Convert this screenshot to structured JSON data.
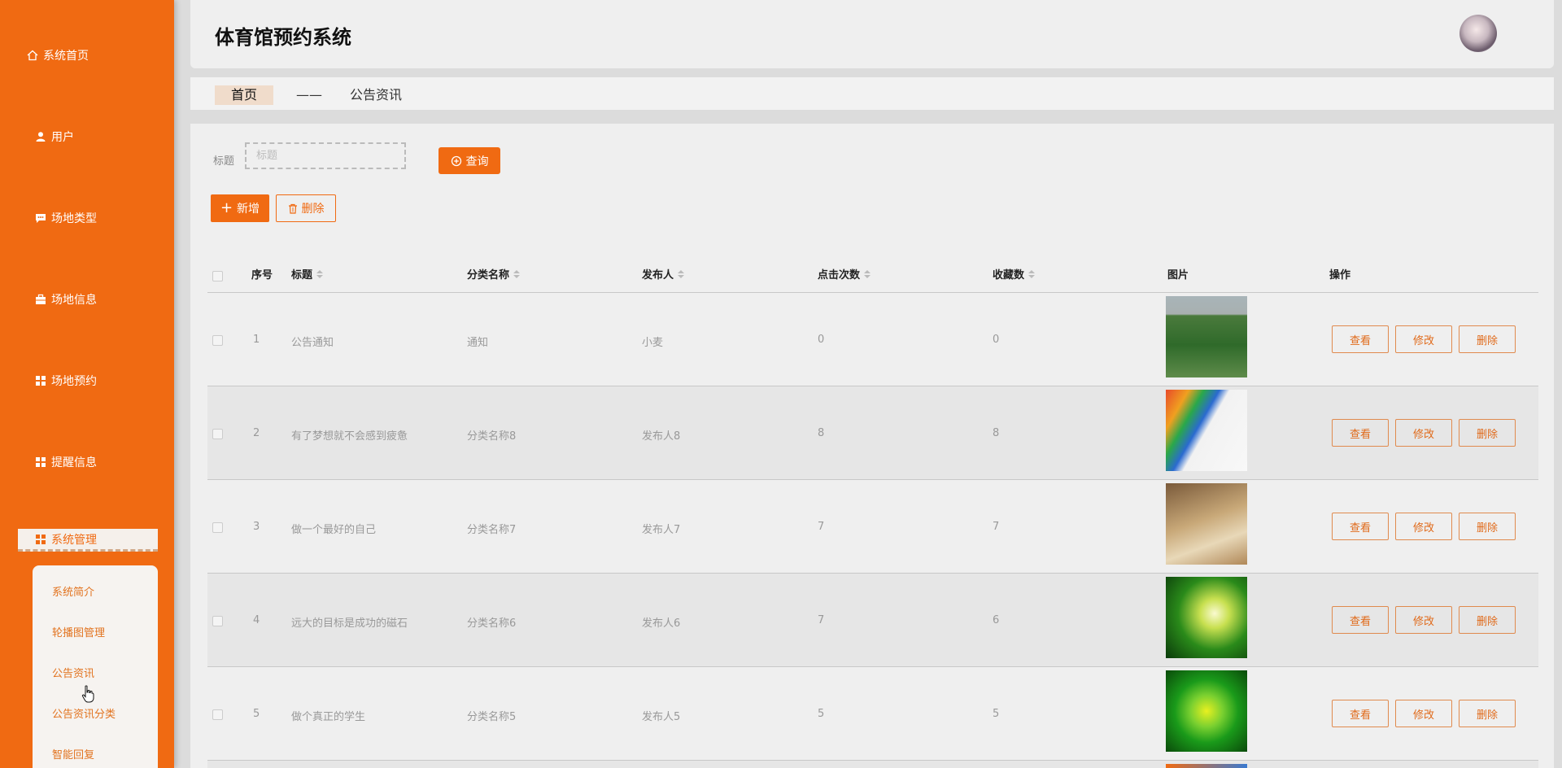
{
  "app": {
    "title": "体育馆预约系统"
  },
  "sidebar": {
    "items": [
      {
        "label": "系统首页",
        "icon": "home-icon"
      },
      {
        "label": "用户",
        "icon": "user-icon"
      },
      {
        "label": "场地类型",
        "icon": "chat-icon"
      },
      {
        "label": "场地信息",
        "icon": "briefcase-icon"
      },
      {
        "label": "场地预约",
        "icon": "grid-icon"
      },
      {
        "label": "提醒信息",
        "icon": "grid-icon"
      },
      {
        "label": "系统管理",
        "icon": "grid-icon",
        "active": true
      }
    ],
    "submenu": [
      {
        "label": "系统简介"
      },
      {
        "label": "轮播图管理"
      },
      {
        "label": "公告资讯"
      },
      {
        "label": "公告资讯分类"
      },
      {
        "label": "智能回复"
      }
    ]
  },
  "breadcrumb": {
    "home": "首页",
    "separator": "——",
    "current": "公告资讯"
  },
  "search": {
    "label": "标题",
    "placeholder": "标题",
    "query_label": "查询"
  },
  "toolbar": {
    "add_label": "新增",
    "delete_label": "删除"
  },
  "table": {
    "headers": [
      "序号",
      "标题",
      "分类名称",
      "发布人",
      "点击次数",
      "收藏数",
      "图片",
      "操作"
    ],
    "actions": {
      "view": "查看",
      "edit": "修改",
      "delete": "删除"
    },
    "rows": [
      {
        "index": "1",
        "title": "公告通知",
        "category": "通知",
        "publisher": "小麦",
        "clicks": "0",
        "favorites": "0"
      },
      {
        "index": "2",
        "title": "有了梦想就不会感到疲惫",
        "category": "分类名称8",
        "publisher": "发布人8",
        "clicks": "8",
        "favorites": "8"
      },
      {
        "index": "3",
        "title": "做一个最好的自己",
        "category": "分类名称7",
        "publisher": "发布人7",
        "clicks": "7",
        "favorites": "7"
      },
      {
        "index": "4",
        "title": "远大的目标是成功的磁石",
        "category": "分类名称6",
        "publisher": "发布人6",
        "clicks": "7",
        "favorites": "6"
      },
      {
        "index": "5",
        "title": "做个真正的学生",
        "category": "分类名称5",
        "publisher": "发布人5",
        "clicks": "5",
        "favorites": "5"
      }
    ]
  },
  "colors": {
    "primary": "#f06a12",
    "panel": "#efefef",
    "background": "#dcdcdc"
  }
}
